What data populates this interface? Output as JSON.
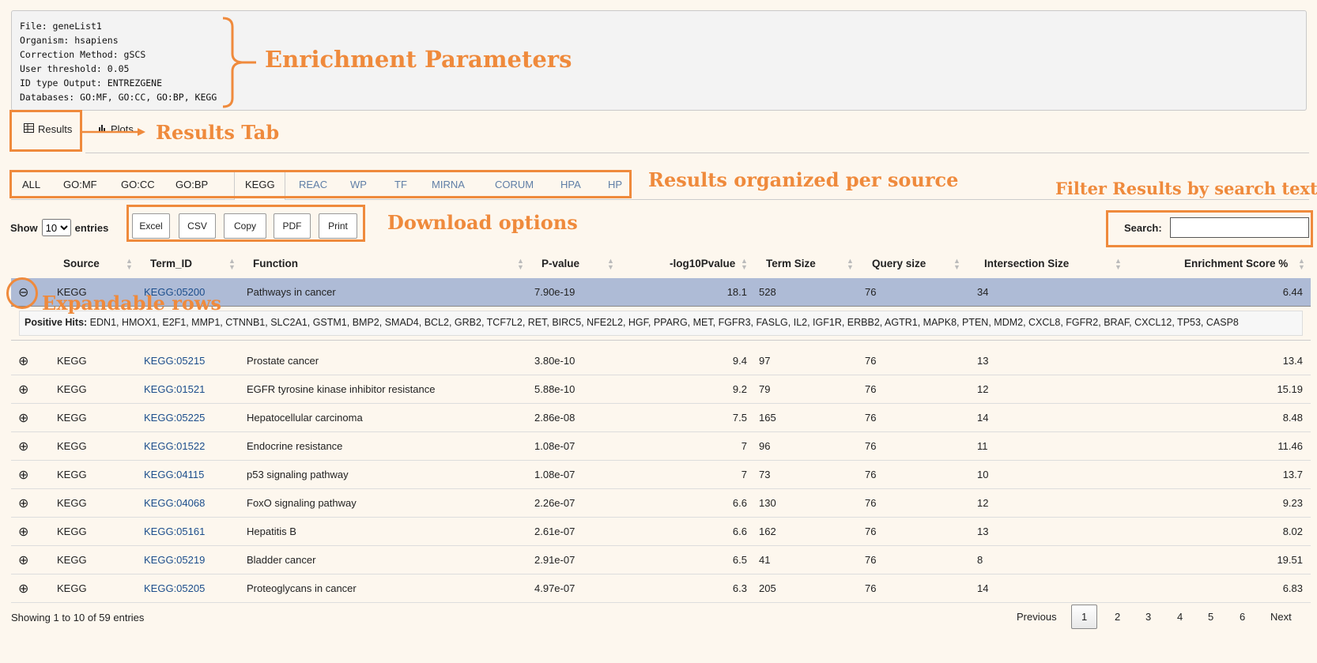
{
  "params": {
    "lines": [
      "File: geneList1",
      "Organism: hsapiens",
      "Correction Method: gSCS",
      "User threshold: 0.05",
      "ID type Output: ENTREZGENE",
      "Databases: GO:MF, GO:CC, GO:BP, KEGG"
    ]
  },
  "annotations": {
    "enrichment": "Enrichment Parameters",
    "results_tab": "Results Tab",
    "per_source": "Results organized per source",
    "filter": "Filter  Results by search text",
    "download": "Download options",
    "expandable": "Expandable rows",
    "color": "#ef8a3c"
  },
  "tabs": {
    "results": "Results",
    "plots": "Plots"
  },
  "sources": [
    "ALL",
    "GO:MF",
    "GO:CC",
    "GO:BP",
    "KEGG",
    "REAC",
    "WP",
    "TF",
    "MIRNA",
    "CORUM",
    "HPA",
    "HP"
  ],
  "active_source": "KEGG",
  "length": {
    "show": "Show",
    "value": "10",
    "entries": "entries"
  },
  "download": [
    "Excel",
    "CSV",
    "Copy",
    "PDF",
    "Print"
  ],
  "search": {
    "label": "Search:",
    "value": ""
  },
  "columns": [
    "Source",
    "Term_ID",
    "Function",
    "P-value",
    "-log10Pvalue",
    "Term Size",
    "Query size",
    "Intersection Size",
    "Enrichment Score %"
  ],
  "rows": [
    {
      "source": "KEGG",
      "term": "KEGG:05200",
      "function": "Pathways in cancer",
      "p": "7.90e-19",
      "log": "18.1",
      "tsize": "528",
      "qsize": "76",
      "isize": "34",
      "score": "6.44",
      "expanded": true
    },
    {
      "source": "KEGG",
      "term": "KEGG:05215",
      "function": "Prostate cancer",
      "p": "3.80e-10",
      "log": "9.4",
      "tsize": "97",
      "qsize": "76",
      "isize": "13",
      "score": "13.4"
    },
    {
      "source": "KEGG",
      "term": "KEGG:01521",
      "function": "EGFR tyrosine kinase inhibitor resistance",
      "p": "5.88e-10",
      "log": "9.2",
      "tsize": "79",
      "qsize": "76",
      "isize": "12",
      "score": "15.19"
    },
    {
      "source": "KEGG",
      "term": "KEGG:05225",
      "function": "Hepatocellular carcinoma",
      "p": "2.86e-08",
      "log": "7.5",
      "tsize": "165",
      "qsize": "76",
      "isize": "14",
      "score": "8.48"
    },
    {
      "source": "KEGG",
      "term": "KEGG:01522",
      "function": "Endocrine resistance",
      "p": "1.08e-07",
      "log": "7",
      "tsize": "96",
      "qsize": "76",
      "isize": "11",
      "score": "11.46"
    },
    {
      "source": "KEGG",
      "term": "KEGG:04115",
      "function": "p53 signaling pathway",
      "p": "1.08e-07",
      "log": "7",
      "tsize": "73",
      "qsize": "76",
      "isize": "10",
      "score": "13.7"
    },
    {
      "source": "KEGG",
      "term": "KEGG:04068",
      "function": "FoxO signaling pathway",
      "p": "2.26e-07",
      "log": "6.6",
      "tsize": "130",
      "qsize": "76",
      "isize": "12",
      "score": "9.23"
    },
    {
      "source": "KEGG",
      "term": "KEGG:05161",
      "function": "Hepatitis B",
      "p": "2.61e-07",
      "log": "6.6",
      "tsize": "162",
      "qsize": "76",
      "isize": "13",
      "score": "8.02"
    },
    {
      "source": "KEGG",
      "term": "KEGG:05219",
      "function": "Bladder cancer",
      "p": "2.91e-07",
      "log": "6.5",
      "tsize": "41",
      "qsize": "76",
      "isize": "8",
      "score": "19.51"
    },
    {
      "source": "KEGG",
      "term": "KEGG:05205",
      "function": "Proteoglycans in cancer",
      "p": "4.97e-07",
      "log": "6.3",
      "tsize": "205",
      "qsize": "76",
      "isize": "14",
      "score": "6.83"
    }
  ],
  "positive_hits": {
    "label": "Positive Hits:",
    "genes": "EDN1, HMOX1, E2F1, MMP1, CTNNB1, SLC2A1, GSTM1, BMP2, SMAD4, BCL2, GRB2, TCF7L2, RET, BIRC5, NFE2L2, HGF, PPARG, MET, FGFR3, FASLG, IL2, IGF1R, ERBB2, AGTR1, MAPK8, PTEN, MDM2, CXCL8, FGFR2, BRAF, CXCL12, TP53, CASP8"
  },
  "footer": {
    "info": "Showing 1 to 10 of 59 entries",
    "previous": "Previous",
    "pages": [
      "1",
      "2",
      "3",
      "4",
      "5",
      "6"
    ],
    "next": "Next"
  }
}
